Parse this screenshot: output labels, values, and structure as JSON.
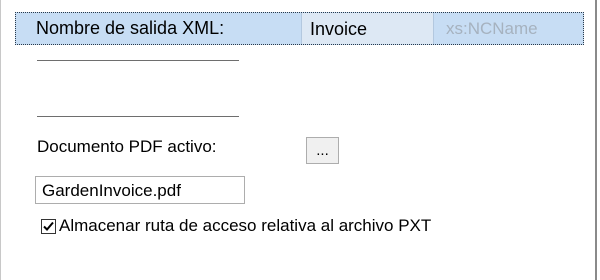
{
  "xml_output": {
    "label": "Nombre de salida XML:",
    "value": "Invoice",
    "type": "xs:NCName"
  },
  "pdf": {
    "label": "Documento PDF activo:",
    "browse_label": "...",
    "file_name": "GardenInvoice.pdf"
  },
  "relative_path": {
    "checked": true,
    "label": "Almacenar ruta de acceso relativa al archivo PXT",
    "check_icon": "checkmark-icon"
  },
  "colors": {
    "selected_row_bg": "#c7ddf4",
    "value_cell_bg": "#dde8f4",
    "type_text": "#a6b2bf"
  }
}
